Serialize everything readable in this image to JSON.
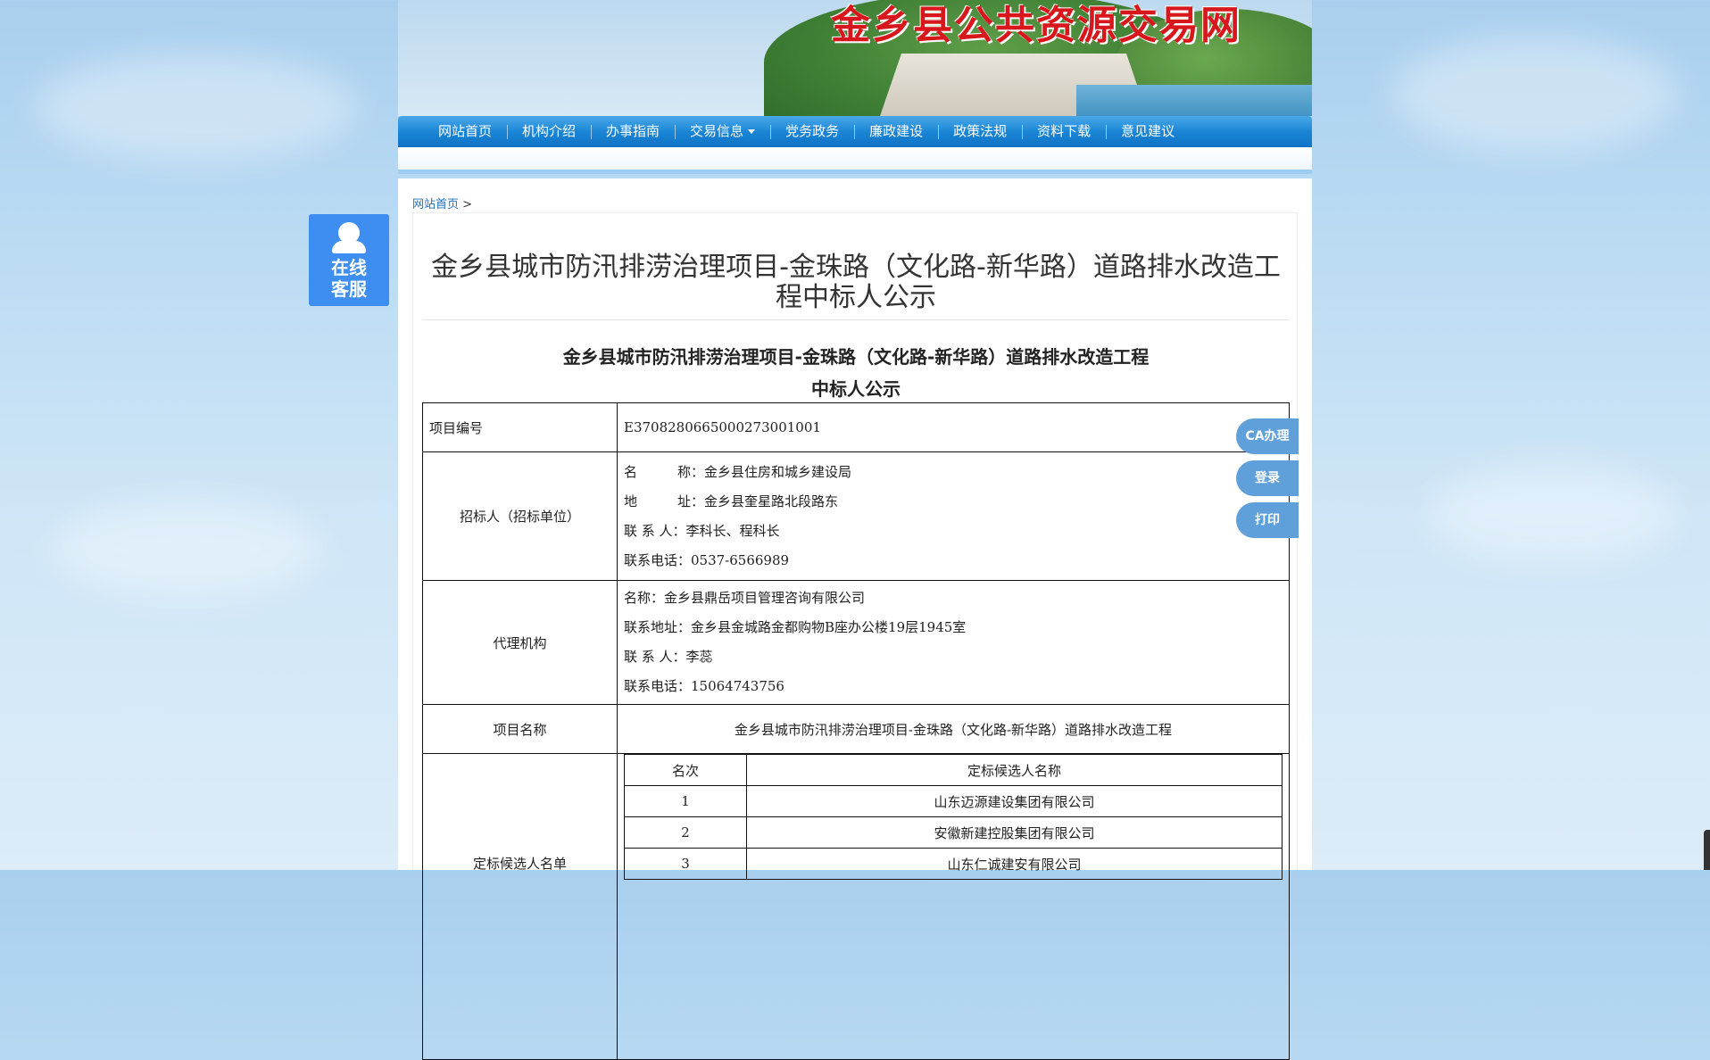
{
  "site": {
    "logo_text": "金乡县公共资源交易网"
  },
  "nav": {
    "items": [
      {
        "label": "网站首页"
      },
      {
        "label": "机构介绍"
      },
      {
        "label": "办事指南"
      },
      {
        "label": "交易信息",
        "has_dropdown": true
      },
      {
        "label": "党务政务"
      },
      {
        "label": "廉政建设"
      },
      {
        "label": "政策法规"
      },
      {
        "label": "资料下载"
      },
      {
        "label": "意见建议"
      }
    ]
  },
  "breadcrumb": {
    "home": "网站首页",
    "separator": ">"
  },
  "article": {
    "title_line1": "金乡县城市防汛排涝治理项目-金珠路（文化路-新华路）道路排水改造工",
    "title_line2": "程中标人公示",
    "doc_head_line1": "金乡县城市防汛排涝治理项目-金珠路（文化路-新华路）道路排水改造工程",
    "doc_head_line2": "中标人公示",
    "table": {
      "project_id_label": "项目编号",
      "project_id_value": "E3708280665000273001001",
      "tenderer_label": "招标人（招标单位）",
      "tenderer_lines": [
        "名　　　称：金乡县住房和城乡建设局",
        "地　　　址：金乡县奎星路北段路东",
        "联 系 人：李科长、程科长",
        "联系电话：0537-6566989"
      ],
      "agency_label": "代理机构",
      "agency_lines": [
        "名称：金乡县鼎岳项目管理咨询有限公司",
        "联系地址：金乡县金城路金都购物B座办公楼19层1945室",
        "联 系 人：李蕊",
        "联系电话：15064743756"
      ],
      "project_name_label": "项目名称",
      "project_name_value": "金乡县城市防汛排涝治理项目-金珠路（文化路-新华路）道路排水改造工程",
      "candidates_label": "定标候选人名单",
      "candidates_header": {
        "rank": "名次",
        "name": "定标候选人名称"
      },
      "candidates": [
        {
          "rank": "1",
          "name": "山东迈源建设集团有限公司"
        },
        {
          "rank": "2",
          "name": "安徽新建控股集团有限公司"
        },
        {
          "rank": "3",
          "name": "山东仁诚建安有限公司"
        }
      ]
    }
  },
  "side": {
    "kefu_line1": "在线",
    "kefu_line2": "客服",
    "float_buttons": [
      "CA办理",
      "登录",
      "打印"
    ]
  },
  "colors": {
    "nav_blue": "#1b86d6",
    "logo_red": "#d8171c",
    "float_btn": "#5fa0db",
    "kefu_blue": "#3d8ef0"
  }
}
